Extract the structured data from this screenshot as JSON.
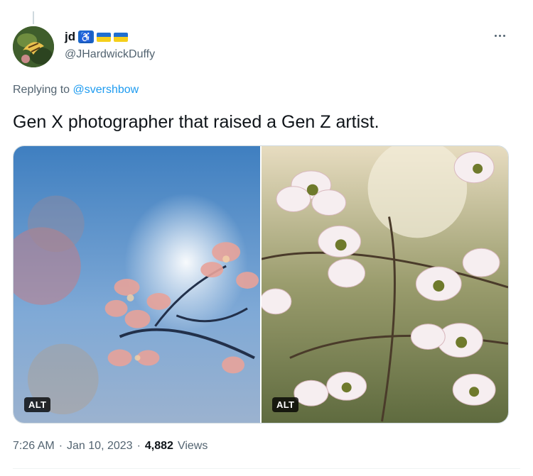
{
  "author": {
    "display_name": "jd",
    "accessibility_icon": "♿",
    "handle": "@JHardwickDuffy"
  },
  "reply": {
    "prefix": "Replying to",
    "to_handle": "@svershbow"
  },
  "tweet": {
    "text": "Gen X photographer that raised a Gen Z artist."
  },
  "media": {
    "left_alt": "ALT",
    "right_alt": "ALT"
  },
  "meta": {
    "time": "7:26 AM",
    "separator1": "·",
    "date": "Jan 10, 2023",
    "separator2": "·",
    "views_count": "4,882",
    "views_label": "Views"
  },
  "colors": {
    "accent": "#1d9bf0",
    "secondary_text": "#536471",
    "primary_text": "#0f1419"
  }
}
